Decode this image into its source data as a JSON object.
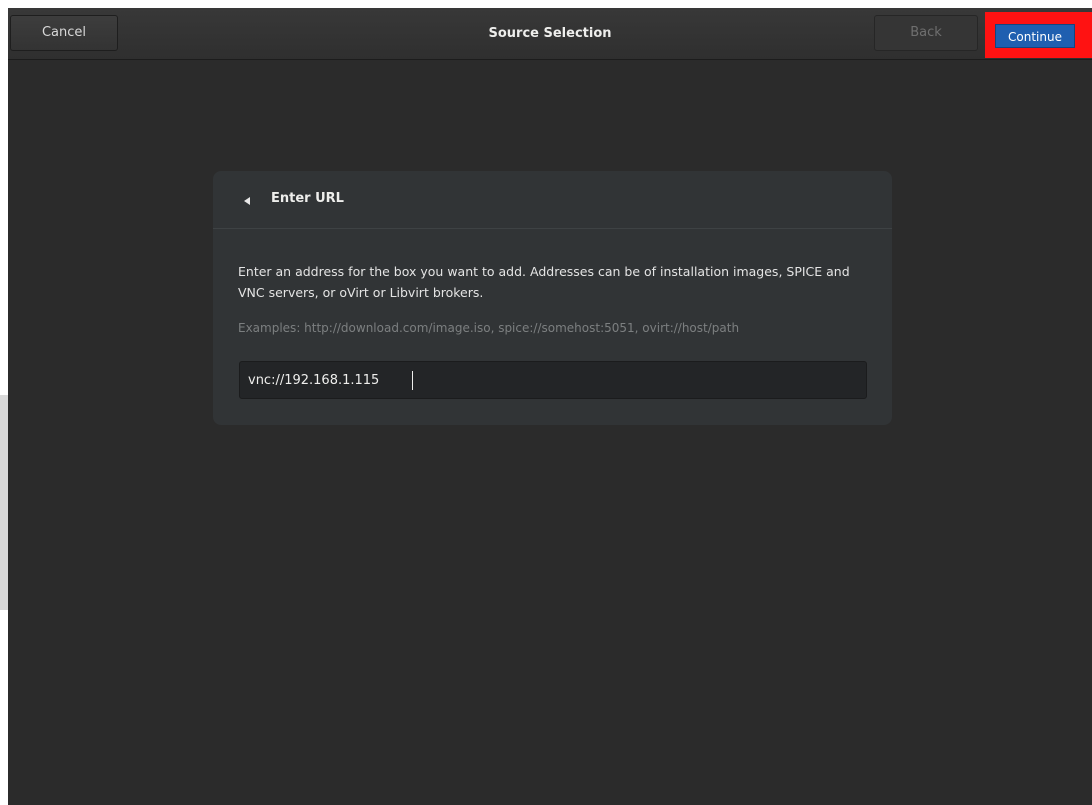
{
  "header": {
    "title": "Source Selection",
    "cancel_label": "Cancel",
    "back_label": "Back",
    "continue_label": "Continue"
  },
  "card": {
    "title": "Enter URL",
    "description": "Enter an address for the box you want to add. Addresses can be of installation images, SPICE and VNC servers, or oVirt or Libvirt brokers.",
    "examples": "Examples: http://download.com/image.iso, spice://somehost:5051, ovirt://host/path",
    "url_value": "vnc://192.168.1.115"
  },
  "icons": {
    "back_arrow": "back-arrow-icon"
  },
  "colors": {
    "background": "#2b2b2b",
    "highlight": "#ff1212",
    "accent": "#1f5fb0"
  }
}
